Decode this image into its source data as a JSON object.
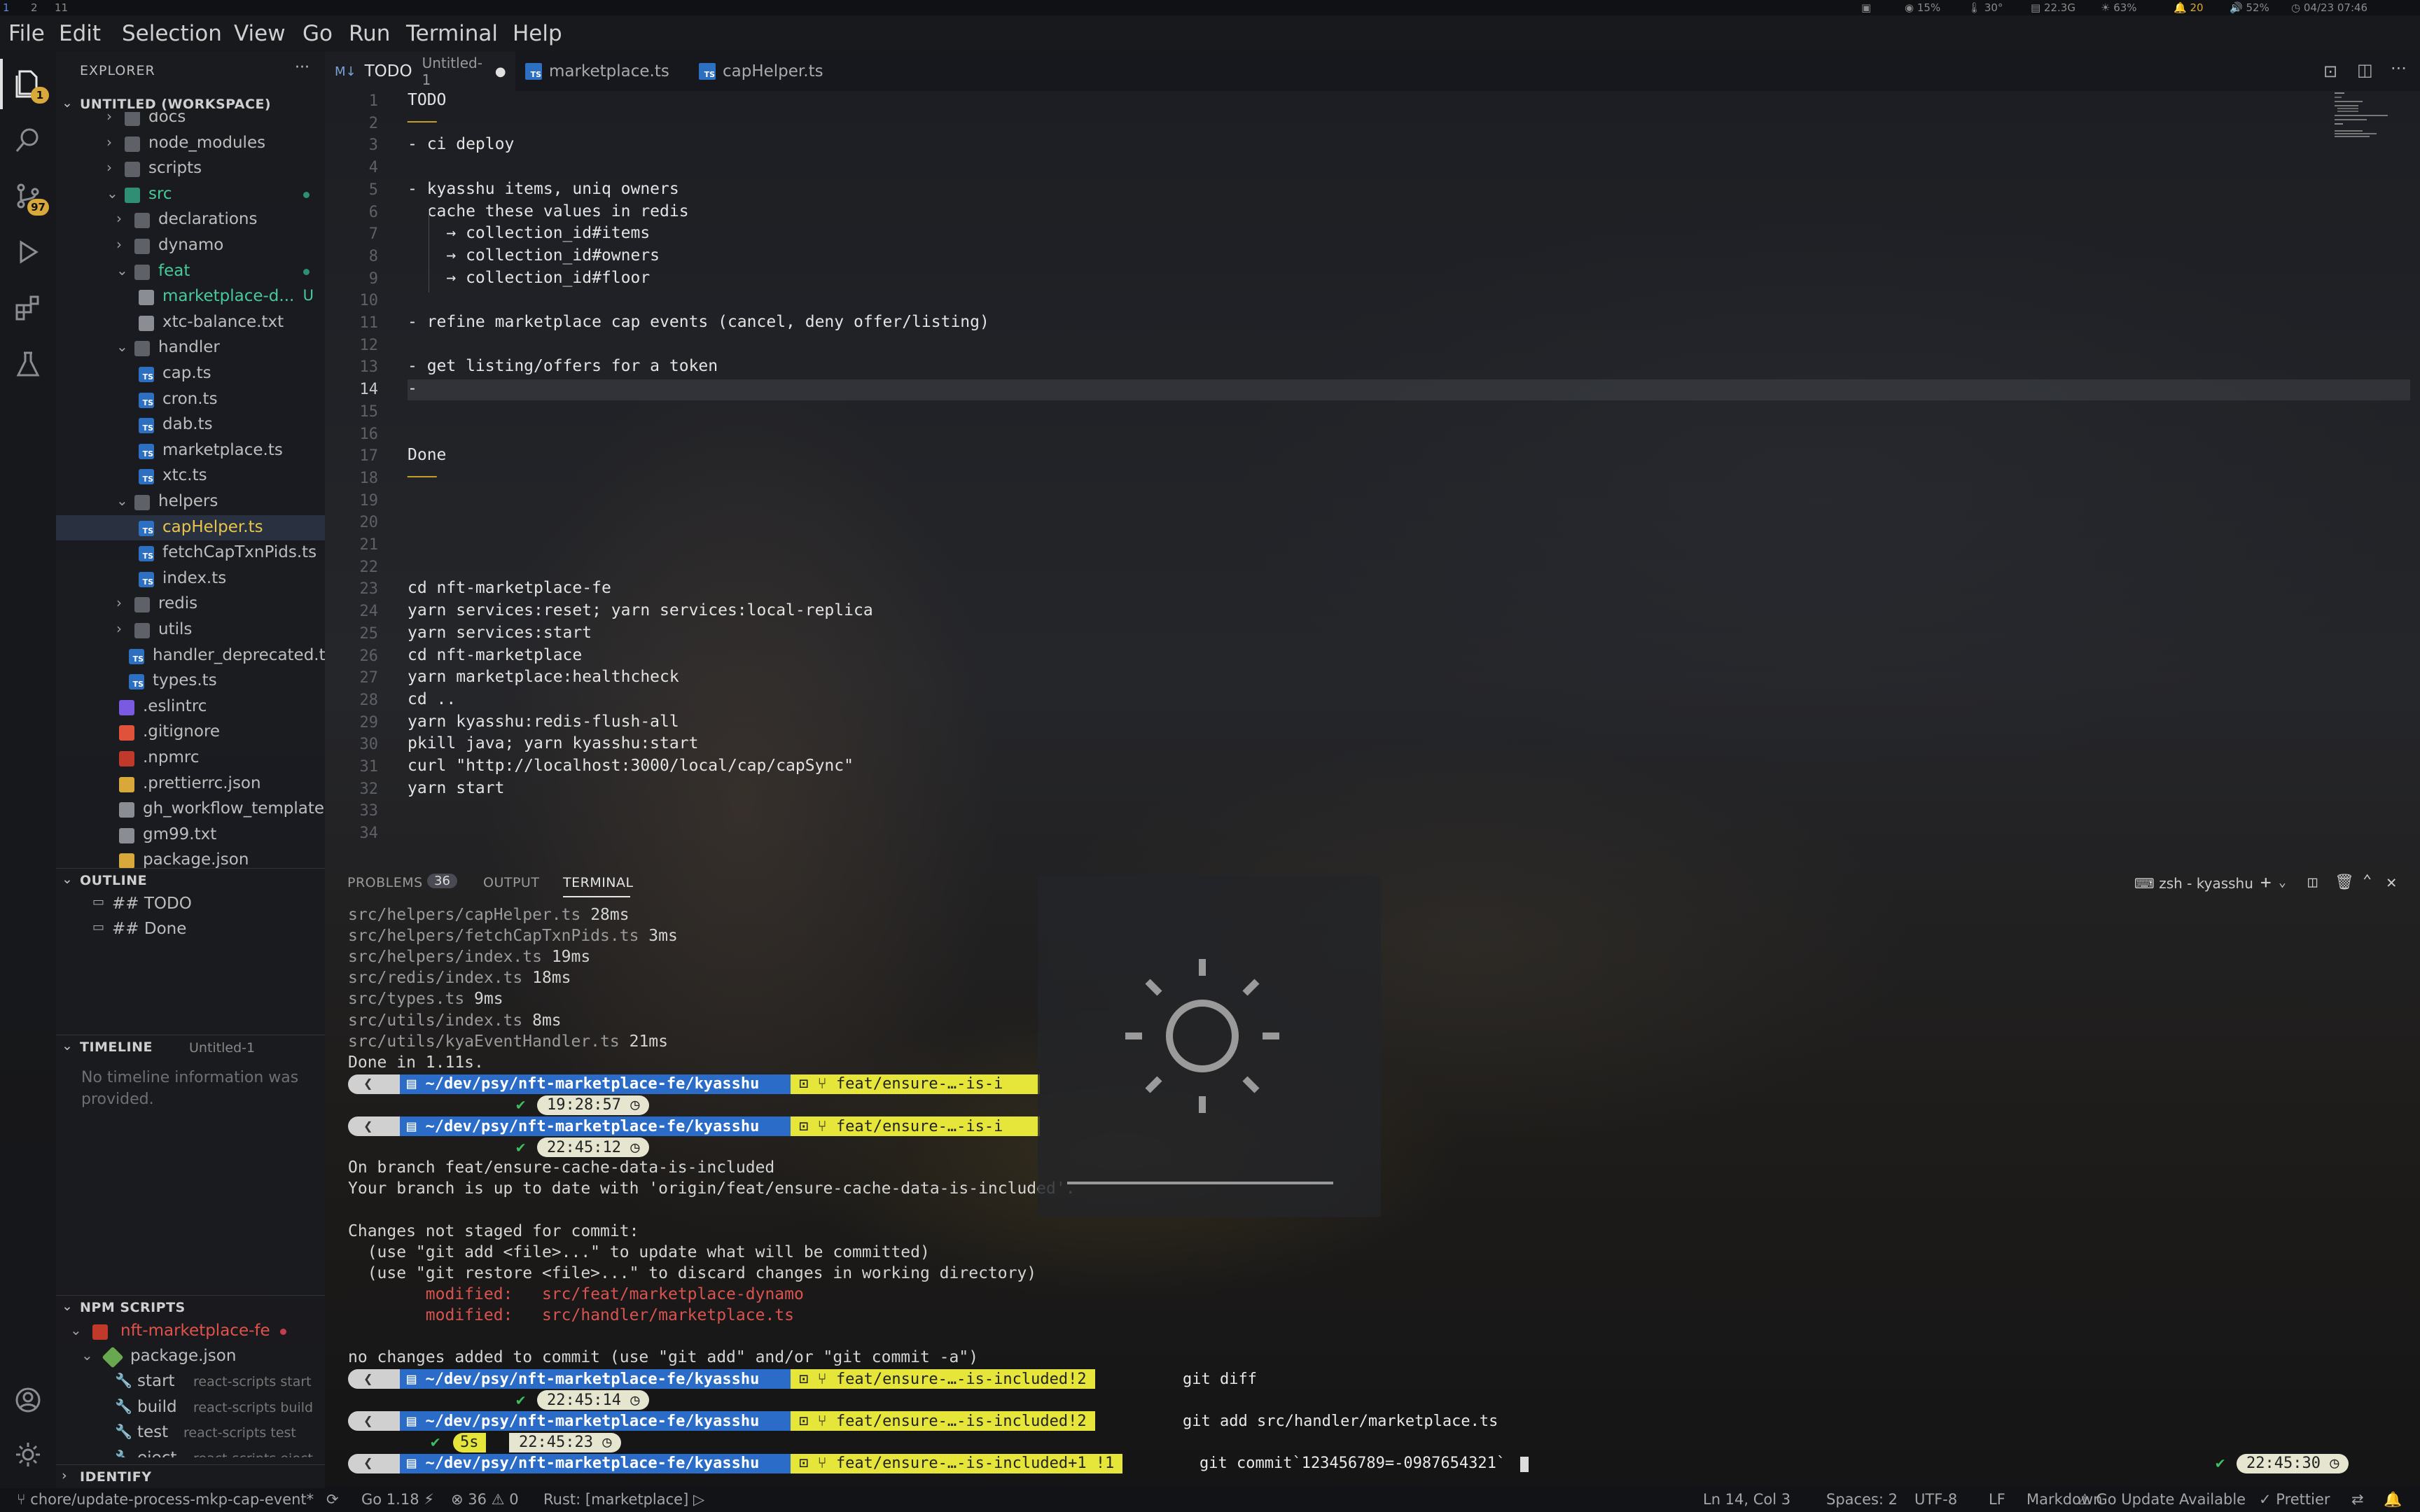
{
  "topbar": {
    "workspaces": [
      "1",
      "2",
      "11"
    ],
    "status": [
      "15%",
      "30°",
      "22.3G",
      "63%",
      "20",
      "52%",
      "04/23 07:46"
    ]
  },
  "menu": [
    "File",
    "Edit",
    "Selection",
    "View",
    "Go",
    "Run",
    "Terminal",
    "Help"
  ],
  "activity": {
    "explorer_badge": "1",
    "scm_badge": "97"
  },
  "sidebar": {
    "header": "EXPLORER",
    "workspace": "UNTITLED (WORKSPACE)",
    "tree": [
      {
        "name": "docs",
        "kind": "folder",
        "depth": 1,
        "open": false
      },
      {
        "name": "node_modules",
        "kind": "node",
        "depth": 1,
        "open": false
      },
      {
        "name": "scripts",
        "kind": "folder",
        "depth": 1,
        "open": false
      },
      {
        "name": "src",
        "kind": "src",
        "depth": 1,
        "open": true,
        "dot": true
      },
      {
        "name": "declarations",
        "kind": "folder",
        "depth": 2,
        "open": false
      },
      {
        "name": "dynamo",
        "kind": "folder",
        "depth": 2,
        "open": false
      },
      {
        "name": "feat",
        "kind": "folder",
        "depth": 2,
        "open": true,
        "dot": true
      },
      {
        "name": "marketplace-d...",
        "kind": "file",
        "depth": 3,
        "untracked": "U"
      },
      {
        "name": "xtc-balance.txt",
        "kind": "file",
        "depth": 3
      },
      {
        "name": "handler",
        "kind": "folder",
        "depth": 2,
        "open": true
      },
      {
        "name": "cap.ts",
        "kind": "ts",
        "depth": 3
      },
      {
        "name": "cron.ts",
        "kind": "ts",
        "depth": 3
      },
      {
        "name": "dab.ts",
        "kind": "ts",
        "depth": 3
      },
      {
        "name": "marketplace.ts",
        "kind": "ts",
        "depth": 3
      },
      {
        "name": "xtc.ts",
        "kind": "ts",
        "depth": 3
      },
      {
        "name": "helpers",
        "kind": "folder",
        "depth": 2,
        "open": true
      },
      {
        "name": "capHelper.ts",
        "kind": "ts",
        "depth": 3,
        "selected": true
      },
      {
        "name": "fetchCapTxnPids.ts",
        "kind": "ts",
        "depth": 3
      },
      {
        "name": "index.ts",
        "kind": "ts",
        "depth": 3
      },
      {
        "name": "redis",
        "kind": "folder",
        "depth": 2,
        "open": false
      },
      {
        "name": "utils",
        "kind": "folder",
        "depth": 2,
        "open": false
      },
      {
        "name": "handler_deprecated.ts",
        "kind": "ts",
        "depth": 2
      },
      {
        "name": "types.ts",
        "kind": "ts",
        "depth": 2
      },
      {
        "name": ".eslintrc",
        "kind": "eslint",
        "depth": 1
      },
      {
        "name": ".gitignore",
        "kind": "git",
        "depth": 1
      },
      {
        "name": ".npmrc",
        "kind": "npm",
        "depth": 1
      },
      {
        "name": ".prettierrc.json",
        "kind": "json",
        "depth": 1
      },
      {
        "name": "gh_workflow_template",
        "kind": "file",
        "depth": 1
      },
      {
        "name": "gm99.txt",
        "kind": "file",
        "depth": 1
      },
      {
        "name": "package.json",
        "kind": "json",
        "depth": 1
      }
    ],
    "outline_header": "OUTLINE",
    "outline": [
      "## TODO",
      "## Done"
    ],
    "timeline_header": "TIMELINE",
    "timeline_file": "Untitled-1",
    "timeline_empty": "No timeline information was provided.",
    "npm_header": "NPM SCRIPTS",
    "npm_project": "nft-marketplace-fe",
    "npm_package": "package.json",
    "npm_scripts": [
      {
        "name": "start",
        "cmd": "react-scripts start"
      },
      {
        "name": "build",
        "cmd": "react-scripts build"
      },
      {
        "name": "test",
        "cmd": "react-scripts test"
      },
      {
        "name": "eject",
        "cmd": "react-scripts eject"
      }
    ],
    "identify_header": "IDENTIFY"
  },
  "tabs": [
    {
      "label": "TODO",
      "desc": "Untitled-1",
      "dirty": true
    },
    {
      "label": "marketplace.ts"
    },
    {
      "label": "capHelper.ts"
    }
  ],
  "editor": {
    "lines": [
      "TODO",
      "───",
      "- ci deploy",
      "",
      "- kyasshu items, uniq owners",
      "  cache these values in redis",
      "    → collection_id#items",
      "    → collection_id#owners",
      "    → collection_id#floor",
      "",
      "- refine marketplace cap events (cancel, deny offer/listing)",
      "",
      "- get listing/offers for a token",
      "-",
      "",
      "",
      "Done",
      "───",
      "",
      "",
      "",
      "",
      "cd nft-marketplace-fe",
      "yarn services:reset; yarn services:local-replica",
      "yarn services:start",
      "cd nft-marketplace",
      "yarn marketplace:healthcheck",
      "cd ..",
      "yarn kyasshu:redis-flush-all",
      "pkill java; yarn kyasshu:start",
      "curl \"http://localhost:3000/local/cap/capSync\"",
      "yarn start",
      "",
      ""
    ]
  },
  "panel": {
    "tabs": [
      "PROBLEMS",
      "OUTPUT",
      "TERMINAL"
    ],
    "problems_count": "36",
    "terminal_name": "zsh - kyasshu",
    "build_lines": [
      {
        "file": "src/helpers/capHelper.ts",
        "ms": "28ms"
      },
      {
        "file": "src/helpers/fetchCapTxnPids.ts",
        "ms": "3ms"
      },
      {
        "file": "src/helpers/index.ts",
        "ms": "19ms"
      },
      {
        "file": "src/redis/index.ts",
        "ms": "18ms"
      },
      {
        "file": "src/types.ts",
        "ms": "9ms"
      },
      {
        "file": "src/utils/index.ts",
        "ms": "8ms"
      },
      {
        "file": "src/utils/kyaEventHandler.ts",
        "ms": "21ms"
      }
    ],
    "done": "Done in 1.11s.",
    "path": "~/dev/psy/nft-marketplace-fe/kyasshu",
    "branch_short": "feat/ensure-…-is-i",
    "branch": "feat/ensure-…-is-included",
    "time1": "19:28:57",
    "time2": "22:45:12",
    "status_lines": [
      "On branch feat/ensure-cache-data-is-included",
      "Your branch is up to date with 'origin/feat/ensure-cache-data-is-included'.",
      "",
      "Changes not staged for commit:",
      "  (use \"git add <file>...\" to update what will be committed)",
      "  (use \"git restore <file>...\" to discard changes in working directory)"
    ],
    "modified": [
      {
        "label": "modified:",
        "file": "src/feat/marketplace-dynamo"
      },
      {
        "label": "modified:",
        "file": "src/handler/marketplace.ts"
      }
    ],
    "no_changes": "no changes added to commit (use \"git add\" and/or \"git commit -a\")",
    "git_ahead1": "!2",
    "cmd1": "git diff",
    "time3": "22:45:14",
    "git_ahead2": "!2",
    "cmd2": "git add src/handler/marketplace.ts",
    "elapsed": "5s",
    "time4": "22:45:23",
    "git_ahead3": "+1 !1",
    "cmd3": "git commit`123456789=-0987654321`",
    "time5": "22:45:30"
  },
  "statusbar": {
    "branch": "chore/update-process-mkp-cap-event*",
    "go": "Go 1.18",
    "errors": "36",
    "warnings": "0",
    "rust": "Rust: [marketplace]",
    "position": "Ln 14, Col 3",
    "spaces": "Spaces: 2",
    "encoding": "UTF-8",
    "eol": "LF",
    "language": "Markdown",
    "go_update": "Go Update Available",
    "prettier": "Prettier"
  },
  "colors": {
    "accent": "#3b82d6",
    "ts_blue": "#2d6fc0",
    "folder_green": "#2f8f74",
    "prompt_blue": "#2a6cc7",
    "prompt_yellow": "#e6e63a",
    "modified_red": "#d9534f"
  }
}
